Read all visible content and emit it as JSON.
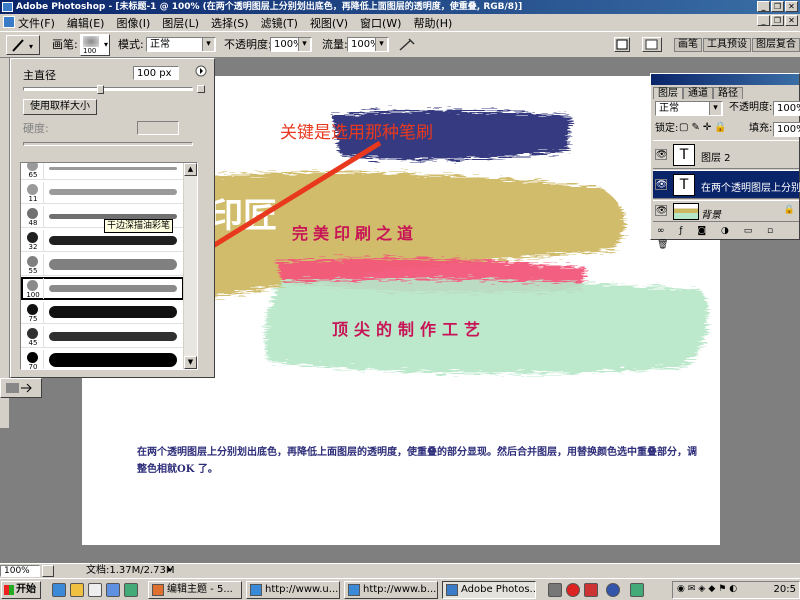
{
  "app": {
    "title": "Adobe Photoshop - [未标题-1 @ 100% (在两个透明图层上分别划出底色，再降低上面图层的透明度，使重叠, RGB/8)]"
  },
  "menu": [
    "文件(F)",
    "编辑(E)",
    "图像(I)",
    "图层(L)",
    "选择(S)",
    "滤镜(T)",
    "视图(V)",
    "窗口(W)",
    "帮助(H)"
  ],
  "options": {
    "brush_label": "画笔:",
    "brush_size": "100",
    "mode_label": "模式:",
    "mode_value": "正常",
    "opacity_label": "不透明度:",
    "opacity_value": "100%",
    "flow_label": "流量:",
    "flow_value": "100%",
    "tabs": [
      "画笔",
      "工具预设",
      "图层复合"
    ]
  },
  "brush_panel": {
    "diameter_label": "主直径",
    "diameter_value": "100 px",
    "use_sample_size": "使用取样大小",
    "hardness_label": "硬度:",
    "brushes": [
      {
        "size": "65",
        "color": "#9a9a9a"
      },
      {
        "size": "11",
        "color": "#9a9a9a"
      },
      {
        "size": "48",
        "color": "#707070"
      },
      {
        "size": "32",
        "color": "#202020"
      },
      {
        "size": "55",
        "color": "#808080"
      },
      {
        "size": "100",
        "color": "#8a8a8a"
      },
      {
        "size": "75",
        "color": "#101010"
      },
      {
        "size": "45",
        "color": "#303030"
      },
      {
        "size": "70",
        "color": "#000000"
      }
    ],
    "tooltip": "干边深描油彩笔"
  },
  "canvas": {
    "logo_text": "印匠",
    "headline1": "完美印刷之道",
    "headline2": "顶尖的制作工艺",
    "body": "在两个透明图层上分别划出底色，再降低上面图层的透明度，使重叠的部分显现。然后合并图层，用替换颜色选中重叠部分，调整色相就OK 了。",
    "annotation": "关键是选用那种笔刷",
    "colors": {
      "navy": "#2b2f78",
      "gold": "#cdb660",
      "pink": "#f2567a",
      "mint": "#b6e6c8",
      "arrow": "#e8391e"
    }
  },
  "layers": {
    "tabs": [
      "图层",
      "通道",
      "路径"
    ],
    "blend_mode": "正常",
    "opacity_label": "不透明度:",
    "opacity_value": "100%",
    "lock_label": "锁定:",
    "fill_label": "填充:",
    "fill_value": "100%",
    "items": [
      {
        "name": "图层 2",
        "type": "T"
      },
      {
        "name": "在两个透明图层上分别...",
        "type": "T"
      },
      {
        "name": "背景",
        "type": "bg"
      }
    ]
  },
  "status": {
    "zoom": "100%",
    "doc": "文档:1.37M/2.73M"
  },
  "taskbar": {
    "start": "开始",
    "tasks": [
      "编辑主题 - 5...",
      "http://www.u...",
      "http://www.b...",
      "Adobe Photos..."
    ],
    "clock": "20:5"
  }
}
